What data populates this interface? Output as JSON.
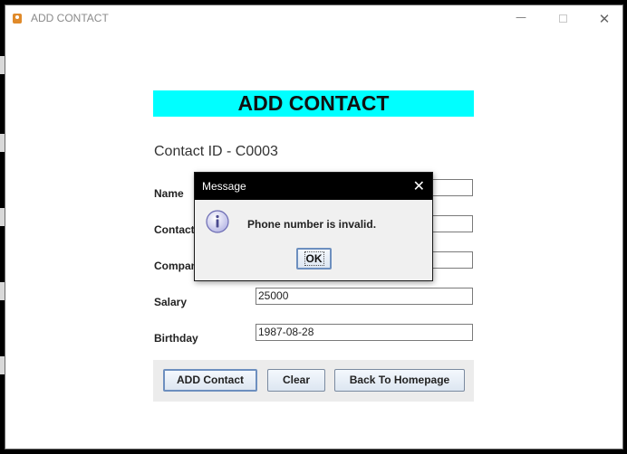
{
  "window": {
    "title": "ADD CONTACT",
    "minimize_glyph": "—",
    "close_glyph": "✕"
  },
  "form": {
    "heading": "ADD CONTACT",
    "contact_id": "Contact ID - C0003",
    "fields": [
      {
        "label": "Name",
        "value": ""
      },
      {
        "label": "Contact",
        "value": ""
      },
      {
        "label": "Compan",
        "value": ""
      },
      {
        "label": "Salary",
        "value": "25000"
      },
      {
        "label": "Birthday",
        "value": "1987-08-28"
      }
    ],
    "buttons": {
      "add": "ADD Contact",
      "clear": "Clear",
      "back": "Back To Homepage"
    }
  },
  "dialog": {
    "title": "Message",
    "close_glyph": "✕",
    "message": "Phone number is invalid.",
    "ok_label": "OK",
    "icon": "info-icon"
  },
  "colors": {
    "heading_bg": "#00ffff",
    "dialog_titlebar": "#000000",
    "button_border": "#6d8fbf"
  }
}
